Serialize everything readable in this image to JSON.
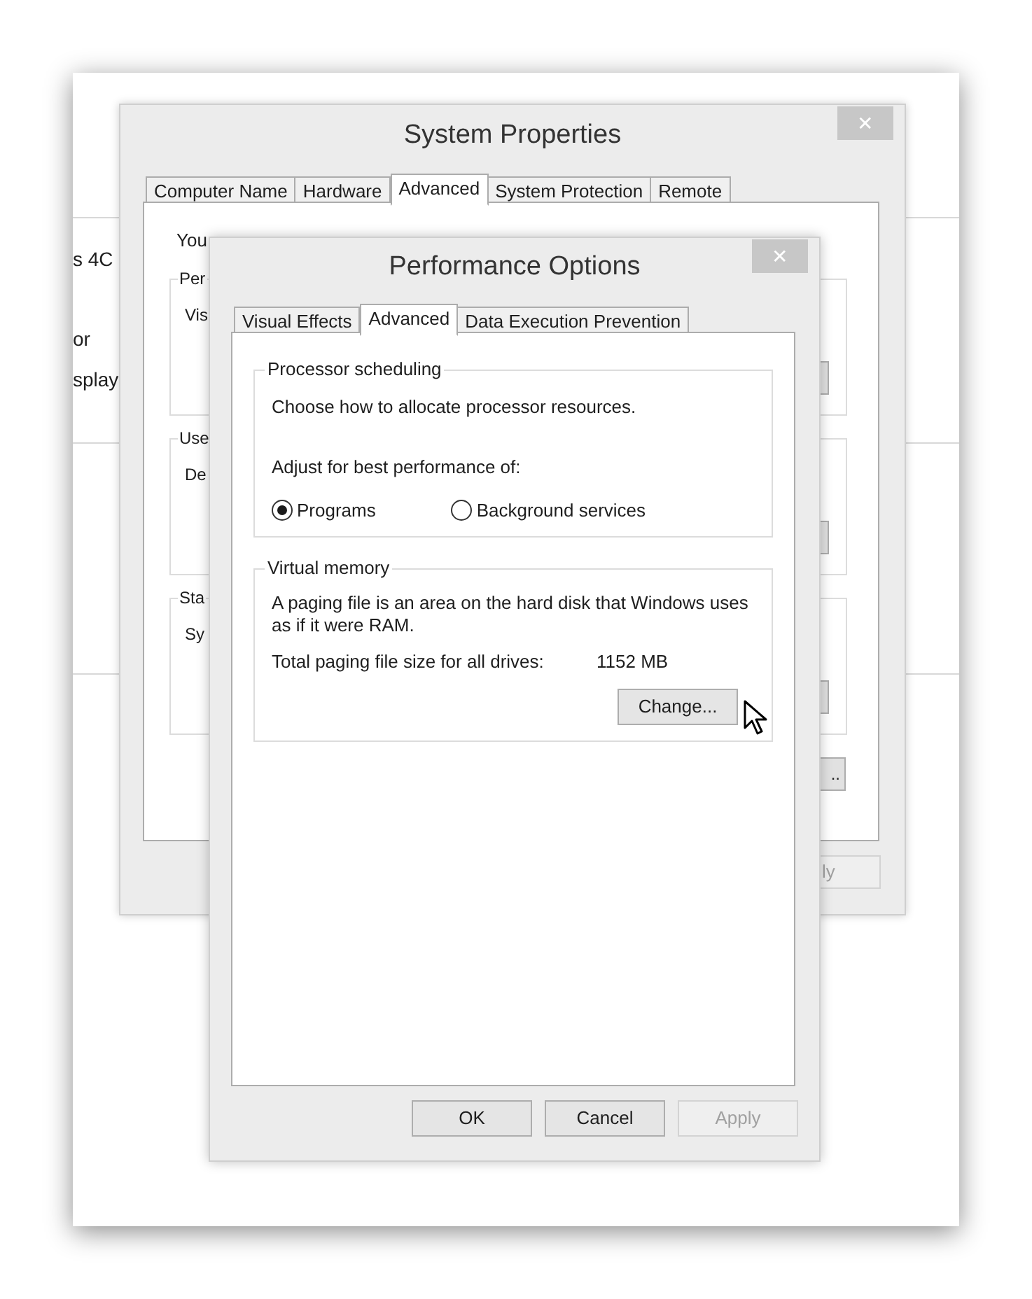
{
  "background_window": {
    "texts": [
      "s 4C",
      "or",
      "splay"
    ]
  },
  "system_properties": {
    "title": "System Properties",
    "close": "✕",
    "tabs": [
      {
        "label": "Computer Name",
        "selected": false
      },
      {
        "label": "Hardware",
        "selected": false
      },
      {
        "label": "Advanced",
        "selected": true
      },
      {
        "label": "System Protection",
        "selected": false
      },
      {
        "label": "Remote",
        "selected": false
      }
    ],
    "notice": "You",
    "groups": [
      {
        "label": "Per",
        "text": "Vis"
      },
      {
        "label": "Use",
        "text": "De"
      },
      {
        "label": "Sta",
        "text": "Sy"
      }
    ],
    "settings_button": "..",
    "apply_button": "ly"
  },
  "performance_options": {
    "title": "Performance Options",
    "close": "✕",
    "tabs": [
      {
        "label": "Visual Effects",
        "selected": false
      },
      {
        "label": "Advanced",
        "selected": true
      },
      {
        "label": "Data Execution Prevention",
        "selected": false
      }
    ],
    "processor_scheduling": {
      "title": "Processor scheduling",
      "description": "Choose how to allocate processor resources.",
      "prompt": "Adjust for best performance of:",
      "options": [
        {
          "label": "Programs",
          "selected": true
        },
        {
          "label": "Background services",
          "selected": false
        }
      ]
    },
    "virtual_memory": {
      "title": "Virtual memory",
      "description": "A paging file is an area on the hard disk that Windows uses as if it were RAM.",
      "total_label": "Total paging file size for all drives:",
      "total_value": "1152 MB",
      "change_button": "Change..."
    },
    "buttons": [
      {
        "label": "OK",
        "disabled": false
      },
      {
        "label": "Cancel",
        "disabled": false
      },
      {
        "label": "Apply",
        "disabled": true
      }
    ]
  }
}
